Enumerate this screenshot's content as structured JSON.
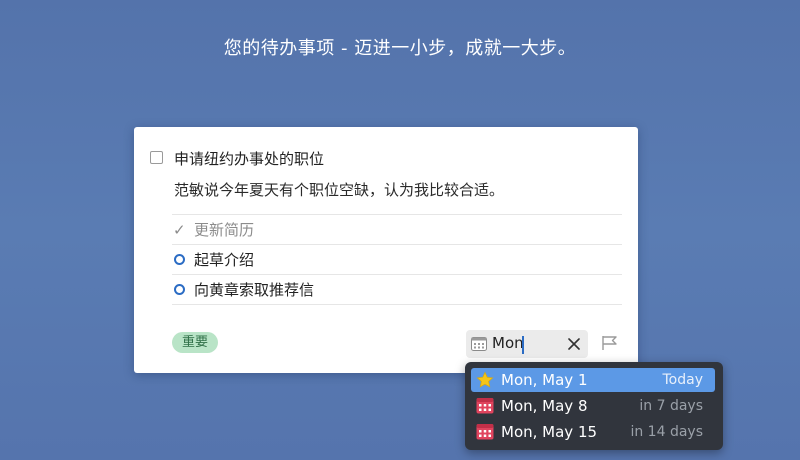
{
  "tagline": "您的待办事项 - 迈进一小步，成就一大步。",
  "task": {
    "title": "申请纽约办事处的职位",
    "notes": "范敏说今年夏天有个职位空缺，认为我比较合适。",
    "checklist": [
      {
        "label": "更新简历",
        "done": true
      },
      {
        "label": "起草介绍",
        "done": false
      },
      {
        "label": "向黄章索取推荐信",
        "done": false
      }
    ],
    "tag": "重要",
    "when_input": "Mon"
  },
  "suggestions": [
    {
      "label": "Mon, May 1",
      "relative": "Today",
      "icon": "star-icon",
      "selected": true
    },
    {
      "label": "Mon, May 8",
      "relative": "in 7 days",
      "icon": "calendar-icon",
      "selected": false
    },
    {
      "label": "Mon, May 15",
      "relative": "in 14 days",
      "icon": "calendar-icon",
      "selected": false
    }
  ],
  "colors": {
    "background": "#5677ae",
    "accent": "#2b6cc4",
    "tag_bg": "#b9e4c7",
    "popup_bg": "#31353d",
    "selection": "#5c99e6",
    "calendar_icon": "#e0445e",
    "star": "#f5c518"
  }
}
